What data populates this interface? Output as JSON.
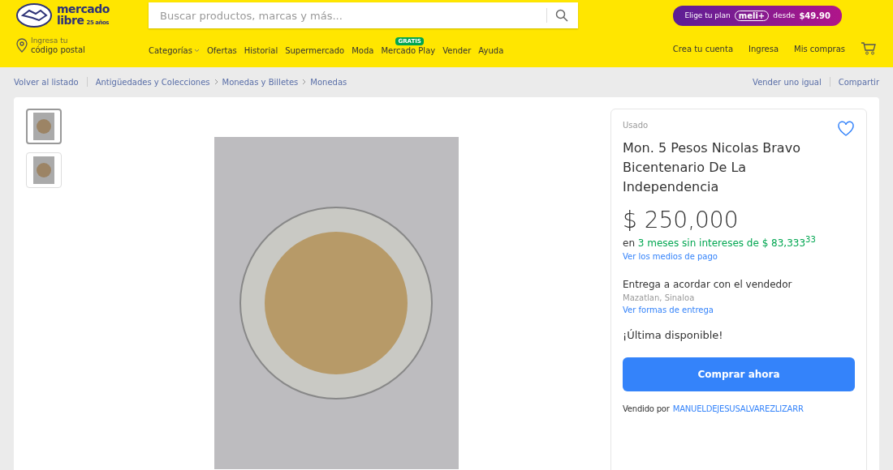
{
  "logo": {
    "line1": "mercado",
    "line2": "libre",
    "anniversary": "25 años"
  },
  "search": {
    "placeholder": "Buscar productos, marcas y más..."
  },
  "promo": {
    "prefix": "Elige tu plan",
    "brand": "meli+",
    "middle": "desde",
    "price": "$49.90"
  },
  "location": {
    "hint": "Ingresa tu",
    "label": "código postal"
  },
  "nav": [
    {
      "label": "Categorías",
      "dropdown": true
    },
    {
      "label": "Ofertas",
      "dropdown": false
    },
    {
      "label": "Historial",
      "dropdown": false
    },
    {
      "label": "Supermercado",
      "dropdown": false
    },
    {
      "label": "Moda",
      "dropdown": false
    },
    {
      "label": "Mercado Play",
      "dropdown": false,
      "badge": "GRATIS"
    },
    {
      "label": "Vender",
      "dropdown": false
    },
    {
      "label": "Ayuda",
      "dropdown": false
    }
  ],
  "account_links": [
    "Crea tu cuenta",
    "Ingresa",
    "Mis compras"
  ],
  "breadcrumb": {
    "back": "Volver al listado",
    "path": [
      "Antigüedades y Colecciones",
      "Monedas y Billetes",
      "Monedas"
    ],
    "actions": [
      "Vender uno igual",
      "Compartir"
    ]
  },
  "thumbnails": [
    {
      "selected": true
    },
    {
      "selected": false
    }
  ],
  "product": {
    "condition": "Usado",
    "favorite": false,
    "title": "Mon. 5 Pesos Nicolas Bravo Bicentenario De La Independencia",
    "price": "$ 250,000",
    "installments_prefix": "en",
    "installments": "3 meses sin intereses de $ 83,333$^{33}$",
    "payment_link": "Ver los medios de pago",
    "delivery": "Entrega a acordar con el vendedor",
    "seller_location": "Mazatlan, Sinaloa",
    "delivery_link": "Ver formas de entrega",
    "stock": "¡Última disponible!",
    "buy_button": "Comprar ahora",
    "sold_by": "Vendido por",
    "seller": "MANUELDEJESUSALVAREZLIZARR"
  }
}
